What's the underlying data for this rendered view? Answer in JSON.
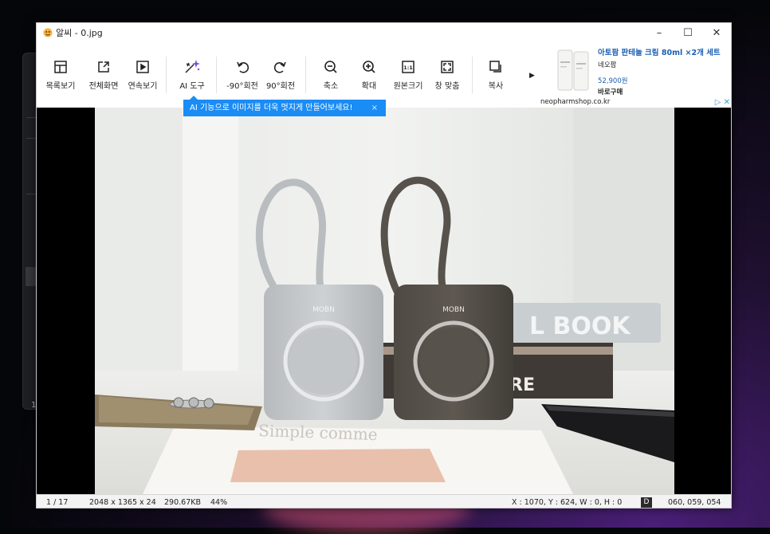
{
  "window": {
    "title": "알씨 - 0.jpg",
    "minimize": "–",
    "maximize": "☐",
    "close": "✕"
  },
  "toolbar": {
    "buttons": [
      {
        "label": "목록보기",
        "icon": "list-view-icon"
      },
      {
        "label": "전체화면",
        "icon": "fullscreen-icon"
      },
      {
        "label": "연속보기",
        "icon": "slideshow-icon"
      },
      {
        "label": "AI 도구",
        "icon": "ai-magic-wand-icon"
      },
      {
        "label": "-90°회전",
        "icon": "rotate-left-icon"
      },
      {
        "label": "90°회전",
        "icon": "rotate-right-icon"
      },
      {
        "label": "축소",
        "icon": "zoom-out-icon"
      },
      {
        "label": "확대",
        "icon": "zoom-in-icon"
      },
      {
        "label": "원본크기",
        "icon": "original-size-icon"
      },
      {
        "label": "창 맞춤",
        "icon": "fit-window-icon"
      },
      {
        "label": "복사",
        "icon": "copy-icon"
      }
    ],
    "more": "▶"
  },
  "ad": {
    "title": "아토팜 판테놀 크림 80ml ×2개 세트",
    "brand": "네오팜",
    "price": "52,900원",
    "cta": "바로구매",
    "domain": "neopharmshop.co.kr",
    "choices": "▷ ✕"
  },
  "tooltip": {
    "text": "AI 기능으로 이미지를 더욱 멋지게 만들어보세요!",
    "close": "×"
  },
  "photo": {
    "brand_text": "MOBN",
    "book_text": "L BOOK",
    "book_text2": "RE",
    "magazine_text": "Simple comme"
  },
  "status": {
    "index": "1 / 17",
    "dimensions": "2048 x 1365 x 24",
    "filesize": "290.67KB",
    "zoom": "44%",
    "selection": "X : 1070, Y : 624, W : 0, H : 0",
    "mode": "D",
    "color": "060, 059, 054"
  },
  "background": {
    "sidebar_number": "1"
  },
  "colors": {
    "accent": "#1a8cf5",
    "ai_icon": "#7b4fe0",
    "ad_link": "#1a5fb4"
  }
}
